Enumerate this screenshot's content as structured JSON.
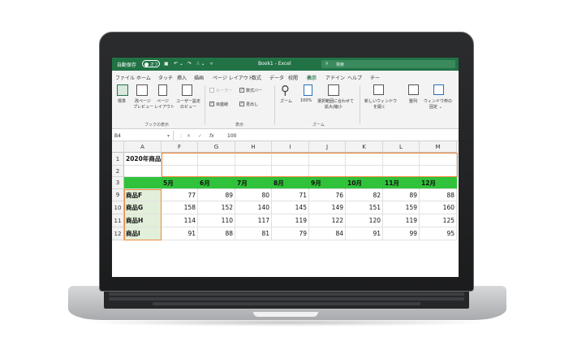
{
  "titlebar": {
    "autosave_label": "自動保存",
    "autosave_state": "オフ",
    "filename": "Book1 - Excel",
    "search_placeholder": "検索"
  },
  "menu": {
    "tabs": [
      "ファイル",
      "ホーム",
      "タッチ",
      "挿入",
      "描画",
      "ページ レイアウト",
      "数式",
      "データ",
      "校閲",
      "表示",
      "アドイン",
      "ヘルプ",
      "チー"
    ],
    "active": "表示"
  },
  "ribbon": {
    "book_views": {
      "normal": "標準",
      "page_break": [
        "改ページ",
        "プレビュー"
      ],
      "page_layout": [
        "ページ",
        "レイアウト"
      ],
      "custom": [
        "ユーザー設定",
        "のビュー"
      ],
      "group": "ブックの表示"
    },
    "show": {
      "ruler": "ルーラー",
      "formula_bar": "数式バー",
      "gridlines": "目盛線",
      "headings": "見出し",
      "group": "表示"
    },
    "zoom": {
      "zoom": "ズーム",
      "hundred": "100%",
      "fit": [
        "選択範囲に合わせて",
        "拡大/縮小"
      ],
      "group": "ズーム"
    },
    "window": {
      "new_window": [
        "新しいウィンドウ",
        "を開く"
      ],
      "arrange": "整列",
      "freeze": [
        "ウィンドウ枠の",
        "固定 ⌄"
      ]
    }
  },
  "formula_bar": {
    "name_box": "B4",
    "fx": "fx",
    "value": "100"
  },
  "sheet": {
    "columns": [
      "A",
      "F",
      "G",
      "H",
      "I",
      "J",
      "K",
      "L",
      "M"
    ],
    "row_numbers": [
      "1",
      "2",
      "3",
      "9",
      "10",
      "11",
      "12"
    ],
    "title_cell": "2020年商品",
    "months": [
      "5月",
      "6月",
      "7月",
      "8月",
      "9月",
      "10月",
      "11月",
      "12月"
    ],
    "rows": [
      {
        "name": "商品F",
        "values": [
          "77",
          "89",
          "80",
          "71",
          "76",
          "82",
          "89",
          "88"
        ]
      },
      {
        "name": "商品G",
        "values": [
          "158",
          "152",
          "140",
          "145",
          "149",
          "151",
          "159",
          "160"
        ]
      },
      {
        "name": "商品H",
        "values": [
          "114",
          "110",
          "117",
          "119",
          "122",
          "120",
          "119",
          "125"
        ]
      },
      {
        "name": "商品I",
        "values": [
          "91",
          "88",
          "81",
          "79",
          "84",
          "91",
          "99",
          "95"
        ]
      }
    ]
  },
  "colors": {
    "excel_green": "#217346",
    "month_fill": "#2fc23a",
    "name_fill": "#e2efda",
    "selection": "#f08a3a"
  }
}
